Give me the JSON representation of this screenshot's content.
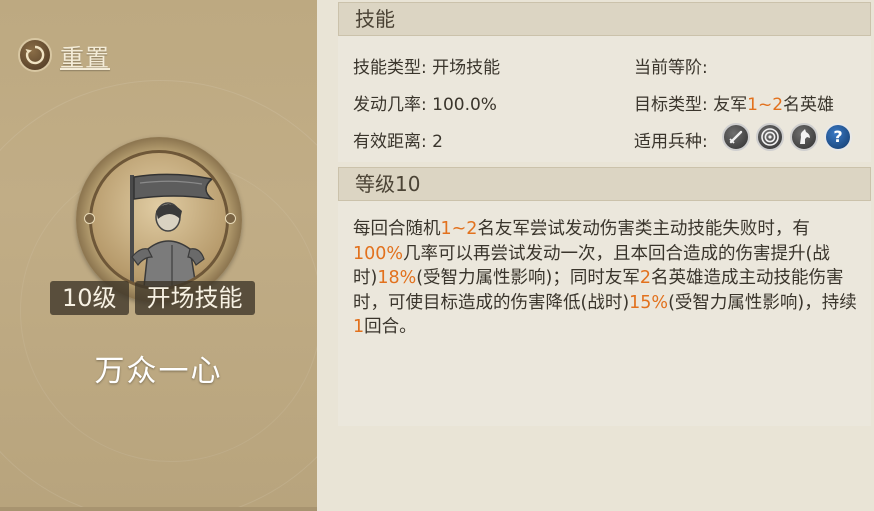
{
  "left_panel": {
    "reset_label": "重置",
    "level_badge": "10级",
    "type_badge": "开场技能",
    "skill_name": "万众一心"
  },
  "skill_section": {
    "header": "技能",
    "type_label": "技能类型:",
    "type_value": "开场技能",
    "rate_label": "发动几率:",
    "rate_value": "100.0%",
    "range_label": "有效距离:",
    "range_value": "2",
    "rank_label": "当前等阶:",
    "target_label": "目标类型:",
    "target_prefix": "友军",
    "target_highlight": "1~2",
    "target_suffix": "名英雄",
    "troop_label": "适用兵种:",
    "troop_icons": [
      "sword-icon",
      "target-icon",
      "horse-icon",
      "question-icon"
    ]
  },
  "level_section": {
    "header": "等级10",
    "description": [
      {
        "text": "每回合随机"
      },
      {
        "text": "1~2",
        "hl": true
      },
      {
        "text": "名友军尝试发动伤害类主动技能失败时，有"
      },
      {
        "text": "100%",
        "hl": true
      },
      {
        "text": "几率可以再尝试发动一次，且本回合造成的伤害提升(战时)"
      },
      {
        "text": "18%",
        "hl": true
      },
      {
        "text": "(受智力属性影响)；同时友军"
      },
      {
        "text": "2",
        "hl": true
      },
      {
        "text": "名英雄造成主动技能伤害时，可使目标造成的伤害降低(战时)"
      },
      {
        "text": "15%",
        "hl": true
      },
      {
        "text": "(受智力属性影响)，持续"
      },
      {
        "text": "1",
        "hl": true
      },
      {
        "text": "回合。"
      }
    ]
  },
  "colors": {
    "highlight": "#e2711d",
    "panel": "#c1ad86"
  }
}
